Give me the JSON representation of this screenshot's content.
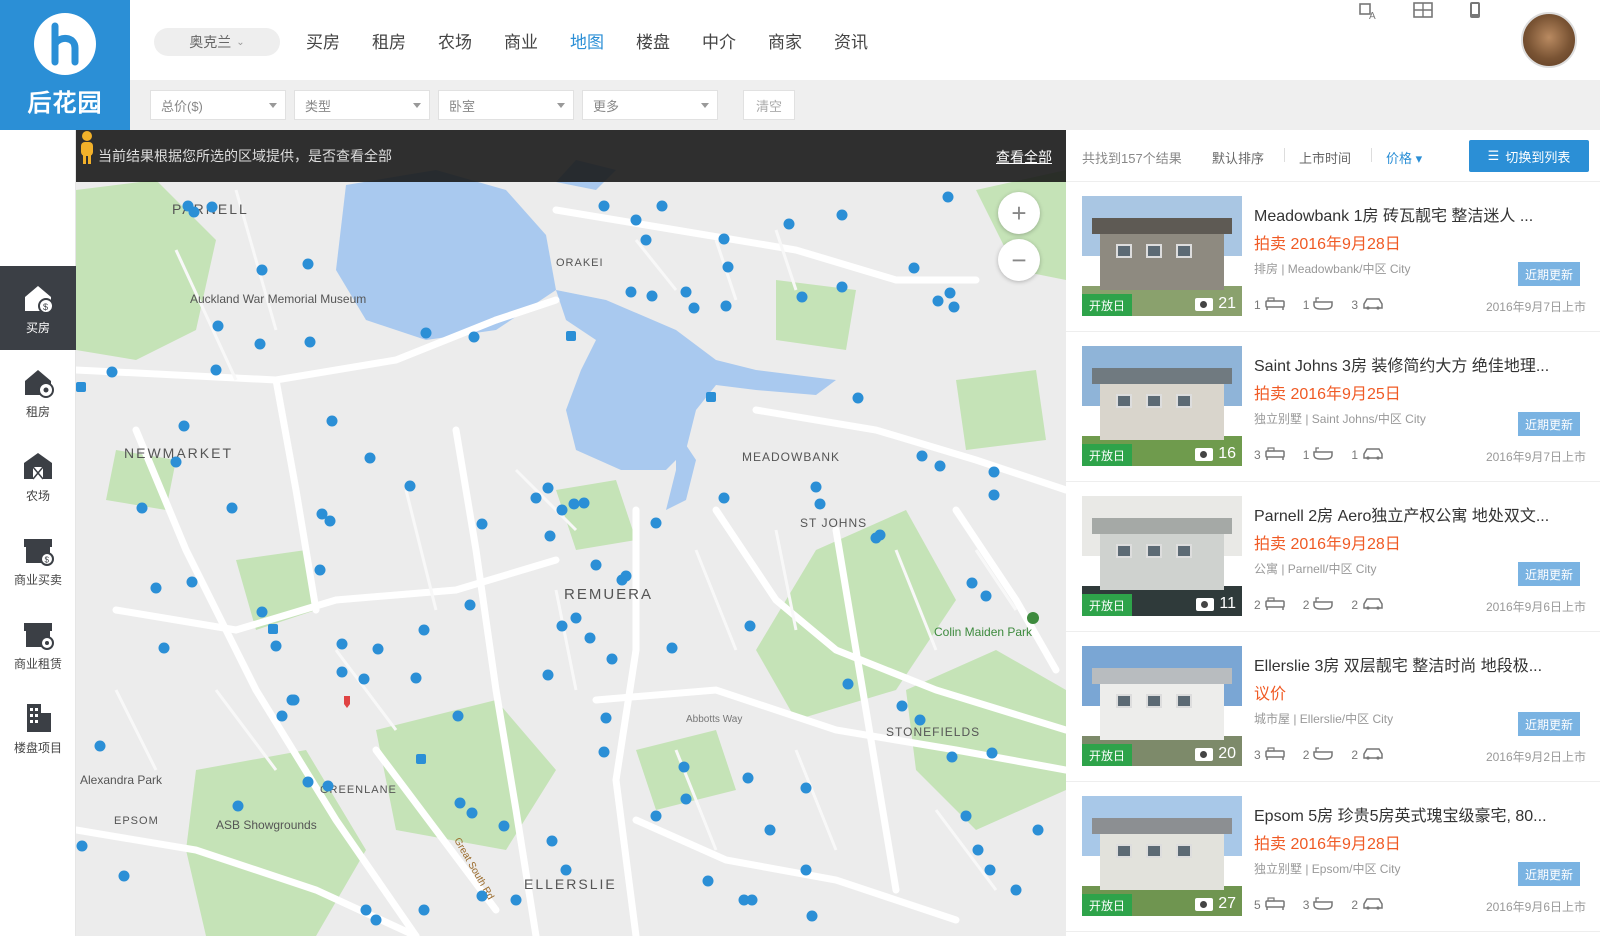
{
  "brand": {
    "name": "后花园",
    "color": "#2b8fd6"
  },
  "nav": {
    "city": "奥克兰",
    "items": [
      {
        "label": "买房",
        "active": false
      },
      {
        "label": "租房",
        "active": false
      },
      {
        "label": "农场",
        "active": false
      },
      {
        "label": "商业",
        "active": false
      },
      {
        "label": "地图",
        "active": true
      },
      {
        "label": "楼盘",
        "active": false
      },
      {
        "label": "中介",
        "active": false
      },
      {
        "label": "商家",
        "active": false
      },
      {
        "label": "资讯",
        "active": false
      }
    ],
    "top_icons": [
      "translate-icon",
      "grid-icon",
      "phone-icon"
    ]
  },
  "filters": {
    "items": [
      "总价($)",
      "类型",
      "卧室",
      "更多"
    ],
    "clear_label": "清空"
  },
  "sidebar": {
    "items": [
      {
        "label": "买房",
        "icon": "house-dollar-icon",
        "active": true
      },
      {
        "label": "租房",
        "icon": "house-key-icon",
        "active": false
      },
      {
        "label": "农场",
        "icon": "farm-icon",
        "active": false
      },
      {
        "label": "商业买卖",
        "icon": "shop-dollar-icon",
        "active": false
      },
      {
        "label": "商业租赁",
        "icon": "shop-key-icon",
        "active": false
      },
      {
        "label": "楼盘项目",
        "icon": "building-icon",
        "active": false
      }
    ]
  },
  "map": {
    "banner_text": "当前结果根据您所选的区域提供，是否查看全部",
    "view_all_label": "查看全部",
    "zoom_in": "+",
    "zoom_out": "−",
    "labels": [
      {
        "text": "PARNELL"
      },
      {
        "text": "Auckland War Memorial Museum"
      },
      {
        "text": "ORAKEI"
      },
      {
        "text": "NEWMARKET"
      },
      {
        "text": "MEADOWBANK"
      },
      {
        "text": "ST JOHNS"
      },
      {
        "text": "REMUERA"
      },
      {
        "text": "Colin Maiden Park"
      },
      {
        "text": "STONEFIELDS"
      },
      {
        "text": "Alexandra Park"
      },
      {
        "text": "GREENLANE"
      },
      {
        "text": "EPSOM"
      },
      {
        "text": "ASB Showgrounds"
      },
      {
        "text": "ELLERSLIE"
      },
      {
        "text": "Abbotts Way"
      },
      {
        "text": "Great South Rd"
      }
    ],
    "colors": {
      "water": "#a9c9ef",
      "park": "#c5e3b7",
      "land": "#ececec",
      "road": "#ffffff",
      "pin": "#2b8fd6"
    }
  },
  "results": {
    "count_text": "共找到157个结果",
    "sort": [
      {
        "label": "默认排序",
        "active": false
      },
      {
        "label": "上市时间",
        "active": false
      },
      {
        "label": "价格",
        "active": true
      }
    ],
    "switch_label": "切换到列表",
    "listings": [
      {
        "title": "Meadowbank 1房 砖瓦靓宅 整洁迷人 ...",
        "price": "拍卖 2016年9月28日",
        "meta": "排房  | Meadowbank/中区 City",
        "badge": "开放日",
        "photos": "21",
        "beds": "1",
        "baths": "1",
        "cars": "3",
        "date": "2016年9月7日上市",
        "button": "近期更新",
        "palette": {
          "sky": "#a9c6e3",
          "house": "#8e8a80",
          "roof": "#5e5a54",
          "ground": "#8aa16d"
        }
      },
      {
        "title": "Saint Johns 3房 装修简约大方 绝佳地理...",
        "price": "拍卖 2016年9月25日",
        "meta": "独立别墅  | Saint Johns/中区 City",
        "badge": "开放日",
        "photos": "16",
        "beds": "3",
        "baths": "1",
        "cars": "1",
        "date": "2016年9月7日上市",
        "button": "近期更新",
        "palette": {
          "sky": "#8fb4d8",
          "house": "#d9d5cc",
          "roof": "#707a80",
          "ground": "#6f9b4d"
        }
      },
      {
        "title": "Parnell 2房 Aero独立产权公寓 地处双文...",
        "price": "拍卖 2016年9月28日",
        "meta": "公寓  | Parnell/中区 City",
        "badge": "开放日",
        "photos": "11",
        "beds": "2",
        "baths": "2",
        "cars": "2",
        "date": "2016年9月6日上市",
        "button": "近期更新",
        "palette": {
          "sky": "#e9e9e6",
          "house": "#cfd2cf",
          "roof": "#a5a9a6",
          "ground": "#2f3a3a"
        }
      },
      {
        "title": "Ellerslie 3房 双层靓宅 整洁时尚 地段极...",
        "price": "议价",
        "meta": "城市屋  | Ellerslie/中区 City",
        "badge": "开放日",
        "photos": "20",
        "beds": "3",
        "baths": "2",
        "cars": "2",
        "date": "2016年9月2日上市",
        "button": "近期更新",
        "palette": {
          "sky": "#7aa6d4",
          "house": "#ededeb",
          "roof": "#b8bcbf",
          "ground": "#7d8a6a"
        }
      },
      {
        "title": "Epsom 5房 珍贵5房英式瑰宝级豪宅, 80...",
        "price": "拍卖 2016年9月28日",
        "meta": "独立别墅  | Epsom/中区 City",
        "badge": "开放日",
        "photos": "27",
        "beds": "5",
        "baths": "3",
        "cars": "2",
        "date": "2016年9月6日上市",
        "button": "近期更新",
        "palette": {
          "sky": "#a8c8e8",
          "house": "#e2e2dc",
          "roof": "#8c8f92",
          "ground": "#6f9550"
        }
      }
    ]
  }
}
